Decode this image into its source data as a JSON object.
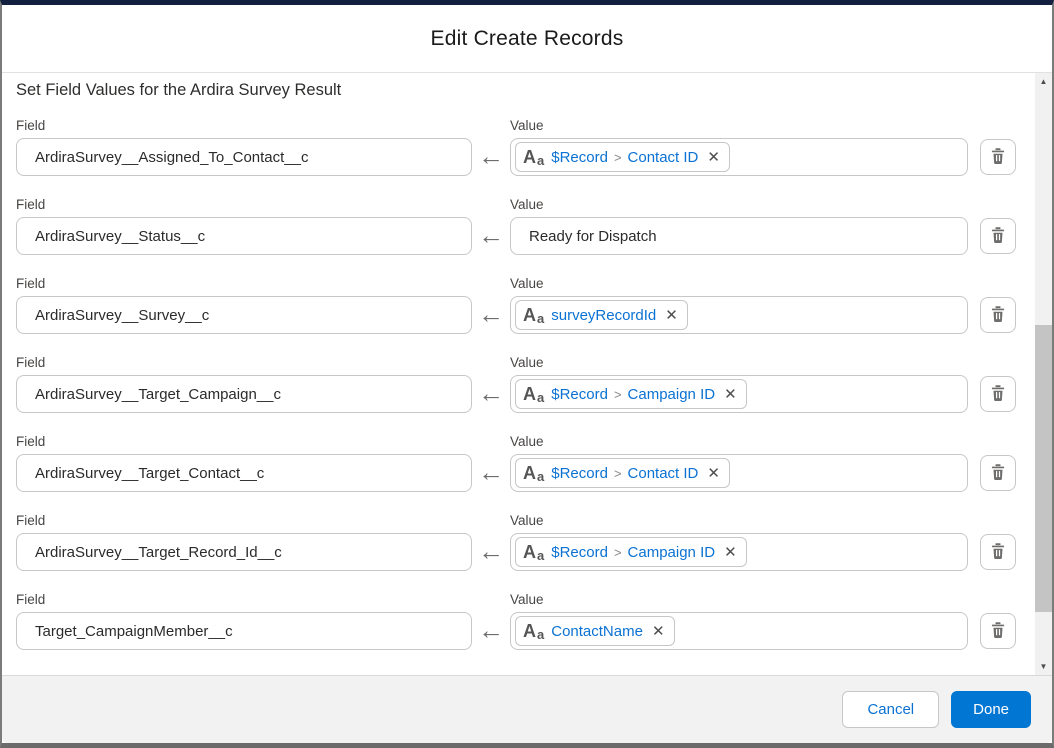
{
  "window": {
    "title": "Edit Create Records"
  },
  "section": {
    "heading": "Set Field Values for the Ardira Survey Result"
  },
  "labels": {
    "field": "Field",
    "value": "Value"
  },
  "rows": [
    {
      "field": "ArdiraSurvey__Assigned_To_Contact__c",
      "value": {
        "type": "pill",
        "parts": [
          "$Record",
          "Contact ID"
        ]
      }
    },
    {
      "field": "ArdiraSurvey__Status__c",
      "value": {
        "type": "text",
        "text": "Ready for Dispatch"
      }
    },
    {
      "field": "ArdiraSurvey__Survey__c",
      "value": {
        "type": "pill",
        "parts": [
          "surveyRecordId"
        ]
      }
    },
    {
      "field": "ArdiraSurvey__Target_Campaign__c",
      "value": {
        "type": "pill",
        "parts": [
          "$Record",
          "Campaign ID"
        ]
      }
    },
    {
      "field": "ArdiraSurvey__Target_Contact__c",
      "value": {
        "type": "pill",
        "parts": [
          "$Record",
          "Contact ID"
        ]
      }
    },
    {
      "field": "ArdiraSurvey__Target_Record_Id__c",
      "value": {
        "type": "pill",
        "parts": [
          "$Record",
          "Campaign ID"
        ]
      }
    },
    {
      "field": "Target_CampaignMember__c",
      "value": {
        "type": "pill",
        "parts": [
          "ContactName"
        ]
      }
    }
  ],
  "icons": {
    "text_type_icon_large": "A",
    "text_type_icon_small": "a",
    "remove_icon": "✕",
    "arrow_left_icon": "←",
    "separator_icon": ">",
    "scroll_up_icon": "▲",
    "scroll_down_icon": "▼"
  },
  "footer": {
    "cancel_label": "Cancel",
    "done_label": "Done"
  },
  "colors": {
    "accent_blue": "#0176d3",
    "pill_text_blue": "#0b72d3",
    "top_border_navy": "#121f3e",
    "icon_gray": "#6f6d6b",
    "footer_bg": "#f2f2f2"
  }
}
